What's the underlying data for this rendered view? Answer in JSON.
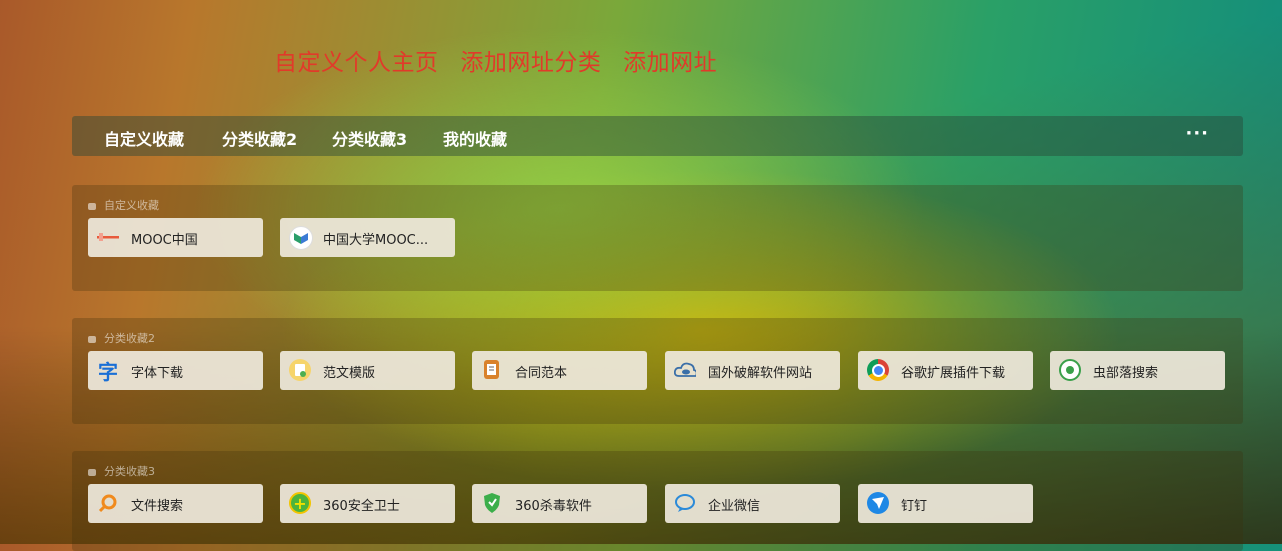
{
  "top_links": [
    "自定义个人主页",
    "添加网址分类",
    "添加网址"
  ],
  "nav": {
    "items": [
      "自定义收藏",
      "分类收藏2",
      "分类收藏3",
      "我的收藏"
    ],
    "more_label": "···"
  },
  "sections": [
    {
      "title": "自定义收藏",
      "items": [
        {
          "label": "MOOC中国",
          "icon": "mooc-icon",
          "color": "#e85a3c"
        },
        {
          "label": "中国大学MOOC...",
          "icon": "icourse-icon",
          "color": "#2a9e6a"
        }
      ]
    },
    {
      "title": "分类收藏2",
      "items": [
        {
          "label": "字体下载",
          "icon": "font-icon",
          "color": "#1a6fd6"
        },
        {
          "label": "范文模版",
          "icon": "document-icon",
          "color": "#f0b93a"
        },
        {
          "label": "合同范本",
          "icon": "contract-icon",
          "color": "#d9822b"
        },
        {
          "label": "国外破解软件网站",
          "icon": "cloud-eye-icon",
          "color": "#3a6fa8"
        },
        {
          "label": "谷歌扩展插件下载",
          "icon": "chrome-icon",
          "color": "#db4437"
        },
        {
          "label": "虫部落搜索",
          "icon": "bug-icon",
          "color": "#3aa04a"
        }
      ]
    },
    {
      "title": "分类收藏3",
      "items": [
        {
          "label": "文件搜索",
          "icon": "search-icon",
          "color": "#f08a1c"
        },
        {
          "label": "360安全卫士",
          "icon": "360-safe-icon",
          "color": "#4cb43c"
        },
        {
          "label": "360杀毒软件",
          "icon": "360-antivirus-icon",
          "color": "#3cae4a"
        },
        {
          "label": "企业微信",
          "icon": "wecom-icon",
          "color": "#2b8ad8"
        },
        {
          "label": "钉钉",
          "icon": "dingtalk-icon",
          "color": "#1e88e5"
        }
      ]
    }
  ]
}
